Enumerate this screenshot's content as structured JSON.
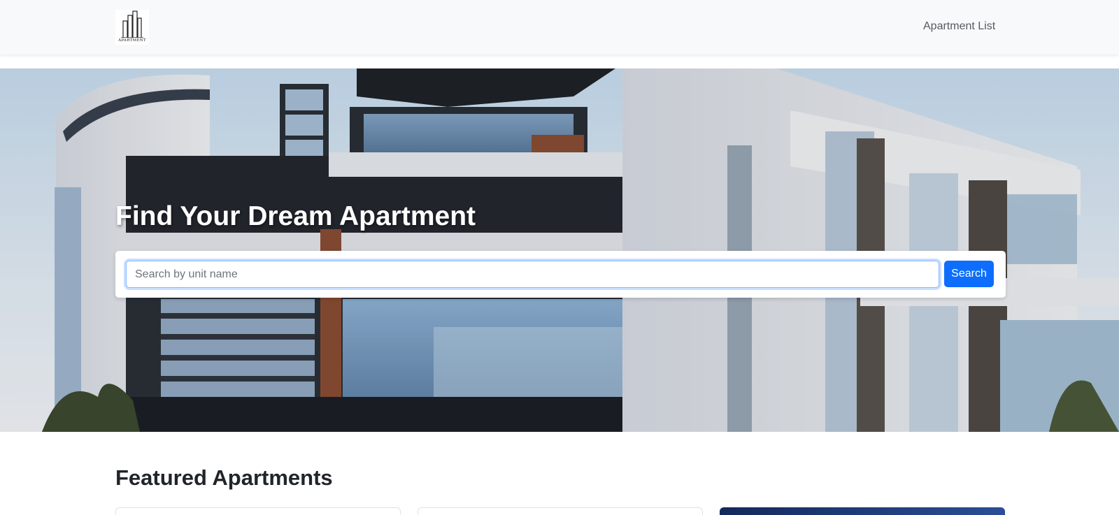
{
  "navbar": {
    "logo": {
      "icon": "building-logo-icon",
      "text": "APARTMENT"
    },
    "link_label": "Apartment List"
  },
  "hero": {
    "title": "Find Your Dream Apartment",
    "search": {
      "value": "",
      "placeholder": "Search by unit name",
      "button_label": "Search"
    }
  },
  "featured": {
    "title": "Featured Apartments",
    "cards": [
      {
        "name": "apartment-card-1"
      },
      {
        "name": "apartment-card-2"
      },
      {
        "name": "apartment-card-3"
      }
    ]
  },
  "colors": {
    "navbar_bg": "#f8f9fa",
    "primary": "#0d6efd",
    "hero_title": "#ffffff"
  }
}
